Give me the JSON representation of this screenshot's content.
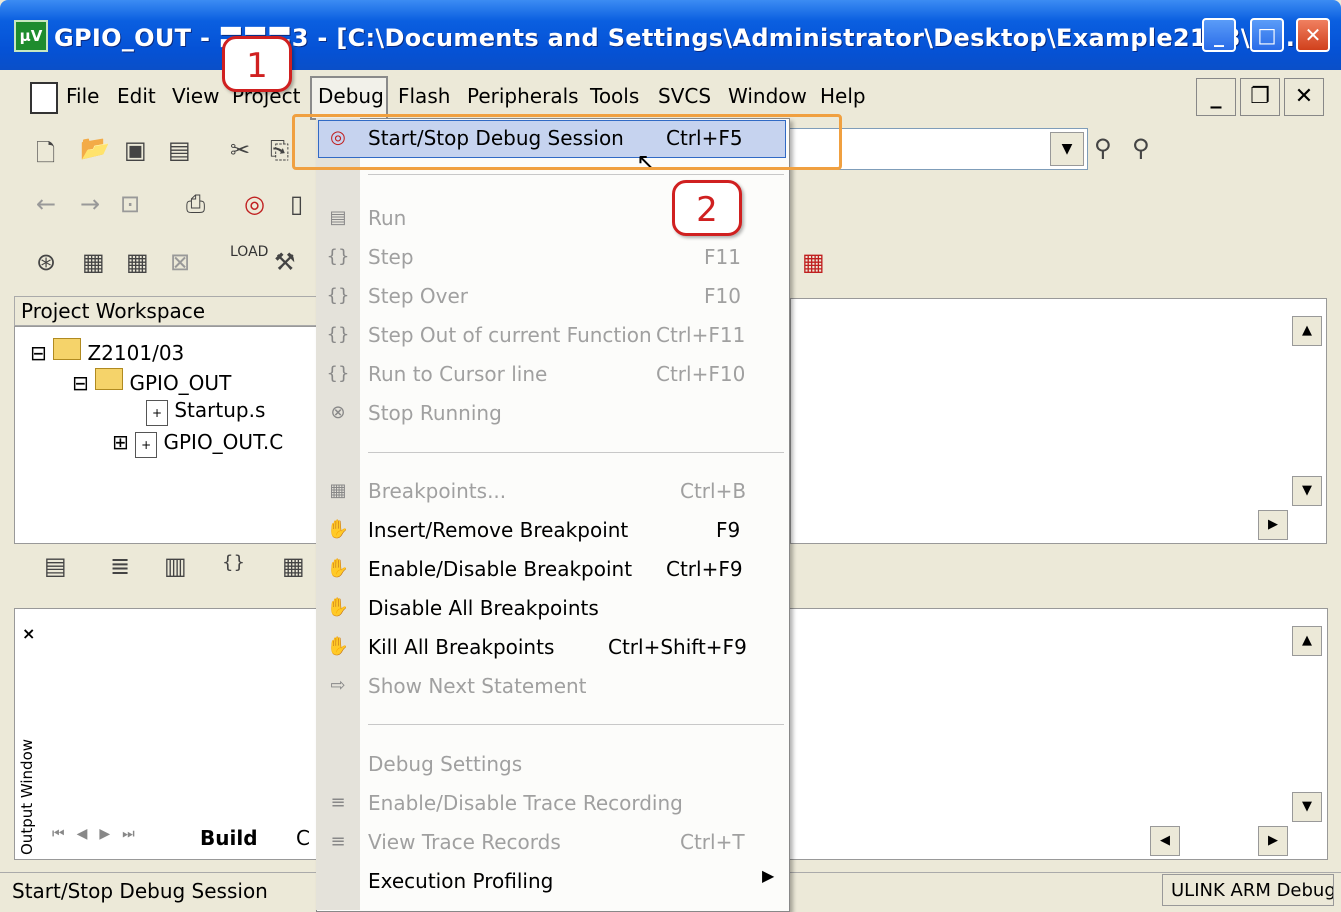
{
  "window": {
    "title": "GPIO_OUT - 〓〓〓3 - [C:\\Documents and Settings\\Administrator\\Desktop\\Example2103\\2....",
    "app_icon": "μV"
  },
  "menubar": {
    "items": [
      "File",
      "Edit",
      "View",
      "Project",
      "Debug",
      "Flash",
      "Peripherals",
      "Tools",
      "SVCS",
      "Window",
      "Help"
    ]
  },
  "workspace": {
    "title": "Project Workspace",
    "tree": [
      "Z2101/03",
      "GPIO_OUT",
      "Startup.s",
      "GPIO_OUT.C"
    ]
  },
  "output": {
    "vertical_label": "Output Window",
    "active_tab": "Build",
    "other_tab": "C"
  },
  "status": {
    "left": "Start/Stop Debug Session",
    "right": "ULINK ARM Debugger"
  },
  "debug_menu": {
    "items": [
      {
        "label": "Start/Stop Debug Session",
        "shortcut": "Ctrl+F5",
        "enabled": true
      },
      {
        "label": "Run",
        "shortcut": "",
        "enabled": false
      },
      {
        "label": "Step",
        "shortcut": "F11",
        "enabled": false
      },
      {
        "label": "Step Over",
        "shortcut": "F10",
        "enabled": false
      },
      {
        "label": "Step Out of current Function",
        "shortcut": "Ctrl+F11",
        "enabled": false
      },
      {
        "label": "Run to Cursor line",
        "shortcut": "Ctrl+F10",
        "enabled": false
      },
      {
        "label": "Stop Running",
        "shortcut": "",
        "enabled": false
      },
      {
        "label": "Breakpoints...",
        "shortcut": "Ctrl+B",
        "enabled": false
      },
      {
        "label": "Insert/Remove Breakpoint",
        "shortcut": "F9",
        "enabled": true
      },
      {
        "label": "Enable/Disable Breakpoint",
        "shortcut": "Ctrl+F9",
        "enabled": true
      },
      {
        "label": "Disable All Breakpoints",
        "shortcut": "",
        "enabled": true
      },
      {
        "label": "Kill All Breakpoints",
        "shortcut": "Ctrl+Shift+F9",
        "enabled": true
      },
      {
        "label": "Show Next Statement",
        "shortcut": "",
        "enabled": false
      },
      {
        "label": "Debug Settings",
        "shortcut": "",
        "enabled": false
      },
      {
        "label": "Enable/Disable Trace Recording",
        "shortcut": "",
        "enabled": false
      },
      {
        "label": "View Trace Records",
        "shortcut": "Ctrl+T",
        "enabled": false
      },
      {
        "label": "Execution Profiling",
        "shortcut": "",
        "enabled": true
      }
    ]
  },
  "annotations": {
    "callout_1": "1",
    "callout_2": "2"
  },
  "colors": {
    "annotation_box": "#f0a040",
    "callout_border": "#d02020",
    "highlight": "#c6d3ef"
  }
}
